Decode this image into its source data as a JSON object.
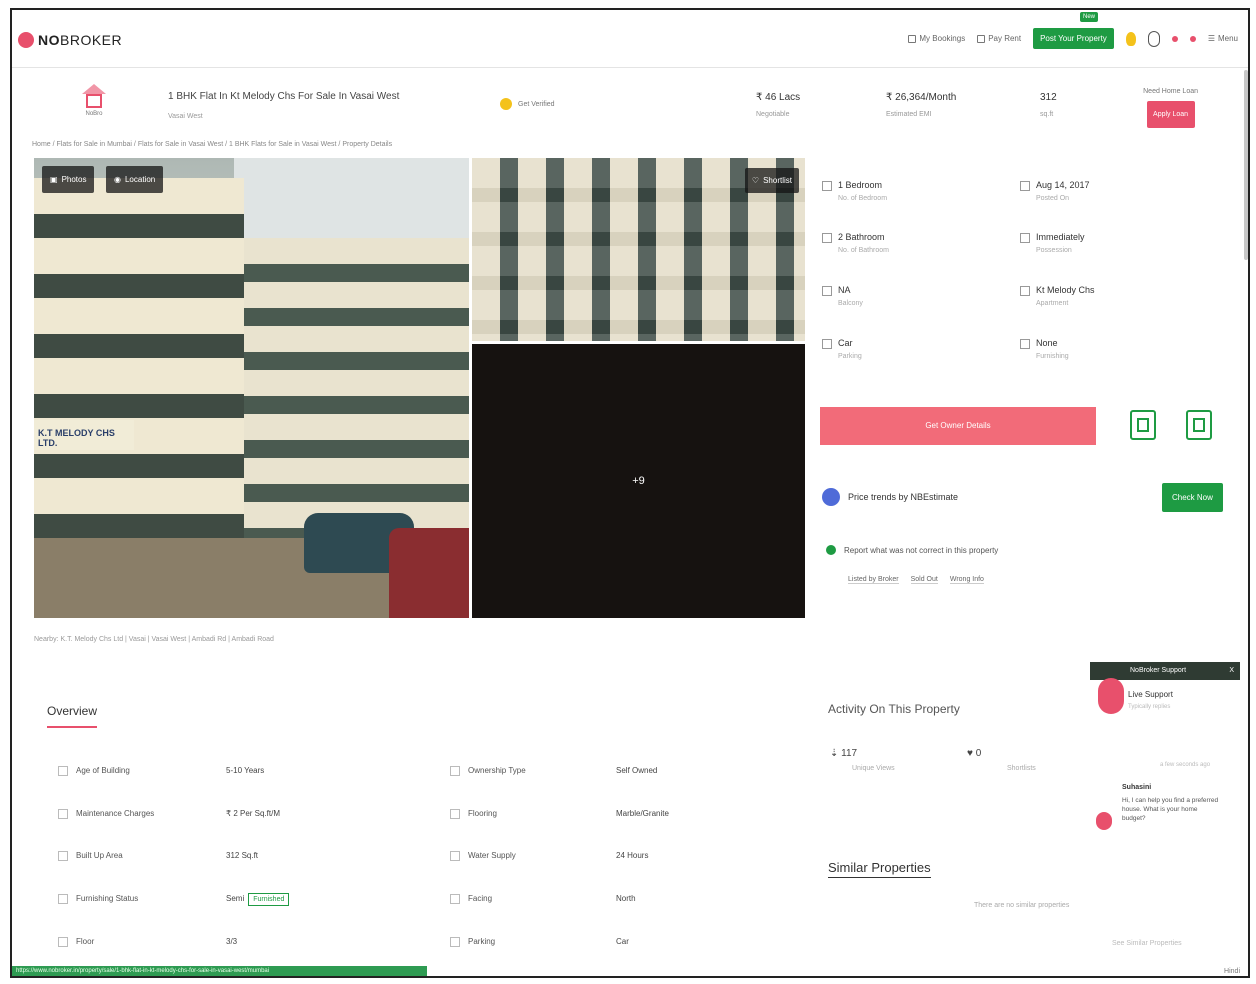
{
  "header": {
    "logo_bold": "NO",
    "logo_rest": "BROKER",
    "nav_items": [
      "My Bookings",
      "Pay Rent"
    ],
    "post_button": "Post Your Property",
    "new_badge": "New",
    "menu_label": "Menu",
    "brand_color": "#e8506c",
    "green_color": "#1e9b43"
  },
  "property": {
    "icon_caption": "NoBro",
    "title": "1 BHK Flat In Kt Melody Chs For Sale In Vasai West",
    "subtitle": "Vasai West",
    "verify_label": "Get Verified",
    "price": "₹ 46 Lacs",
    "price_label": "Negotiable",
    "emi": "₹ 26,364/Month",
    "emi_label": "Estimated EMI",
    "area": "312",
    "area_label": "sq.ft",
    "contact_label": "Need Home Loan",
    "contact_button": "Apply Loan"
  },
  "breadcrumb": "Home  /  Flats for Sale in Mumbai  /  Flats for Sale in Vasai West  /  1 BHK Flats for Sale in Vasai West  /  Property Details",
  "gallery": {
    "photos_button": "Photos",
    "location_button": "Location",
    "shortlist_button": "Shortlist",
    "more_photos": "+9",
    "sign_text": "K.T MELODY CHS LTD.",
    "caption": "Nearby:  K.T. Melody Chs Ltd  |  Vasai  |  Vasai West  |  Ambadi Rd  |  Ambadi Road"
  },
  "details": [
    {
      "value": "1 Bedroom",
      "label": "No. of Bedroom"
    },
    {
      "value": "Aug 14, 2017",
      "label": "Posted On"
    },
    {
      "value": "2 Bathroom",
      "label": "No. of Bathroom"
    },
    {
      "value": "Immediately",
      "label": "Possession"
    },
    {
      "value": "NA",
      "label": "Balcony"
    },
    {
      "value": "Kt Melody Chs",
      "label": "Apartment"
    },
    {
      "value": "Car",
      "label": "Parking"
    },
    {
      "value": "None",
      "label": "Furnishing"
    }
  ],
  "actions": {
    "contact_owner": "Get Owner Details",
    "trend_text": "Price trends by NBEstimate",
    "check_now": "Check Now",
    "report_text": "Report what was not correct in this property",
    "report_options": [
      "Listed by Broker",
      "Sold Out",
      "Wrong Info"
    ]
  },
  "overview": {
    "title": "Overview",
    "left": [
      {
        "label": "Age of Building",
        "value": "5-10 Years"
      },
      {
        "label": "Maintenance Charges",
        "value": "₹ 2 Per Sq.ft/M"
      },
      {
        "label": "Built Up Area",
        "value": "312 Sq.ft"
      },
      {
        "label": "Furnishing Status",
        "value": "Semi",
        "tag": "Furnished"
      },
      {
        "label": "Floor",
        "value": "3/3"
      }
    ],
    "right": [
      {
        "label": "Ownership Type",
        "value": "Self Owned"
      },
      {
        "label": "Flooring",
        "value": "Marble/Granite"
      },
      {
        "label": "Water Supply",
        "value": "24 Hours"
      },
      {
        "label": "Facing",
        "value": "North"
      },
      {
        "label": "Parking",
        "value": "Car"
      }
    ]
  },
  "activity": {
    "title": "Activity On This Property",
    "views": "117",
    "views_label": "Unique Views",
    "shortlists": "0",
    "shortlists_label": "Shortlists"
  },
  "similar": {
    "title": "Similar Properties",
    "empty": "There are no similar properties",
    "link": "See Similar Properties"
  },
  "support": {
    "header": "NoBroker Support",
    "close": "X",
    "live": "Live Support",
    "live_sub": "Typically replies",
    "time": "a few seconds ago",
    "agent": "Suhasini",
    "message": "Hi, I can help you find a preferred house. What is your home budget?"
  },
  "status": {
    "url": "https://www.nobroker.in/property/sale/1-bhk-flat-in-kt-melody-chs-for-sale-in-vasai-west/mumbai",
    "corner": "Hindi"
  }
}
